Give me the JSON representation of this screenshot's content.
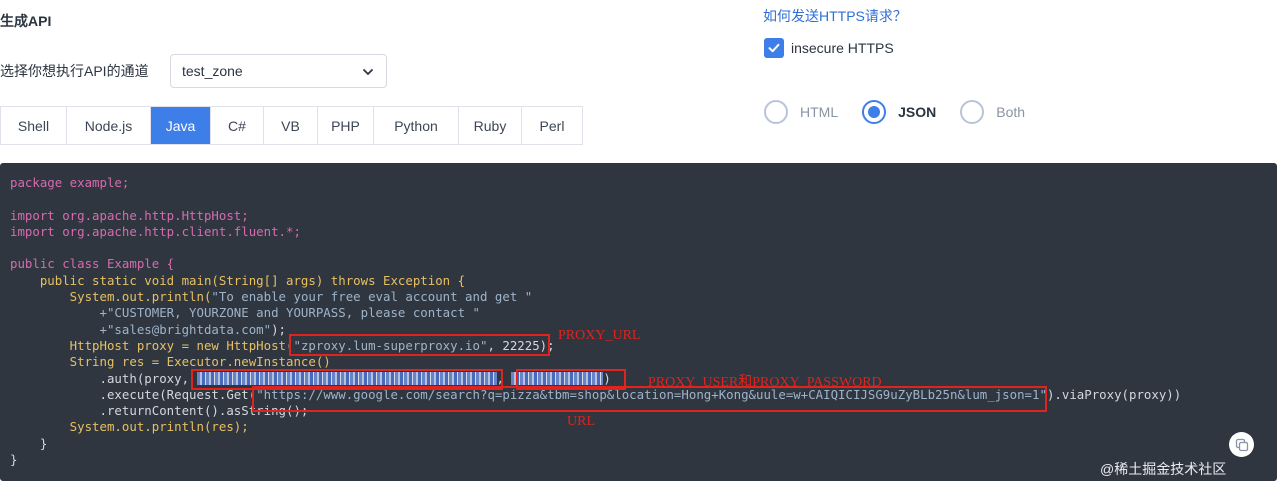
{
  "page": {
    "title": "生成API"
  },
  "channel": {
    "label": "选择你想执行API的通道",
    "selected": "test_zone"
  },
  "tabs": [
    "Shell",
    "Node.js",
    "Java",
    "C#",
    "VB",
    "PHP",
    "Python",
    "Ruby",
    "Perl"
  ],
  "active_tab": "Java",
  "https": {
    "link": "如何发送HTTPS请求？",
    "checkbox_label": "insecure HTTPS",
    "checked": true
  },
  "format": {
    "options": [
      "HTML",
      "JSON",
      "Both"
    ],
    "selected": "JSON"
  },
  "code": {
    "l1": "package example;",
    "l2": "import org.apache.http.HttpHost;",
    "l3": "import org.apache.http.client.fluent.*;",
    "l4": "public class Example {",
    "l5": "    public static void main(String[] args) throws Exception {",
    "l6a": "        System.out.println(",
    "l6b": "\"To enable your free eval account and get \"",
    "l7": "            +\"CUSTOMER, YOURZONE and YOURPASS, please contact \"",
    "l8a": "            +\"sales@brightdata.com\"",
    "l8b": ");",
    "l9a": "        HttpHost proxy = new HttpHost(",
    "l9b": "\"zproxy.lum-superproxy.io\"",
    "l9c": ", 22225);",
    "l10": "        String res = Executor.newInstance()",
    "l11a": "            .auth(proxy, ",
    "l11b": ", ",
    "l11c": ")",
    "l12a": "            .execute(Request.Get(",
    "l12b": "\"https://www.google.com/search?q=pizza&tbm=shop&location=Hong+Kong&uule=w+CAIQICIJSG9uZyBLb25n&lum_json=1\"",
    "l12c": ").viaProxy(proxy))",
    "l13": "            .returnContent().asString();",
    "l14": "        System.out.println(res);",
    "l15": "    }",
    "l16": "}"
  },
  "annotations": {
    "proxy_url": "PROXY_URL",
    "user_pass": "PROXY_USER和PROXY_PASSWORD",
    "url": "URL"
  },
  "watermark": "@稀土掘金技术社区",
  "icons": {
    "select": "chevron-down-icon",
    "checkbox": "check-icon",
    "copy": "copy-icon"
  },
  "colors": {
    "accent": "#3d7ee8",
    "code_bg": "#2f3640",
    "annotation": "#e0231c"
  }
}
